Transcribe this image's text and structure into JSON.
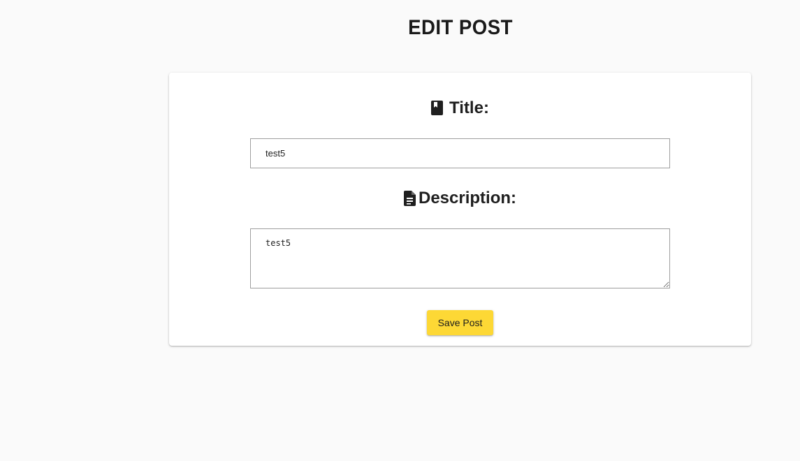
{
  "page": {
    "title": "EDIT POST"
  },
  "form": {
    "title_label": "Title:",
    "title_icon": "book-icon",
    "title_value": "test5",
    "description_label": "Description:",
    "description_icon": "description-document-icon",
    "description_value": "test5",
    "save_label": "Save Post"
  },
  "colors": {
    "background": "#fafafa",
    "card": "#ffffff",
    "button": "#fdd835",
    "text": "#212121",
    "input_border": "#9e9e9e"
  }
}
